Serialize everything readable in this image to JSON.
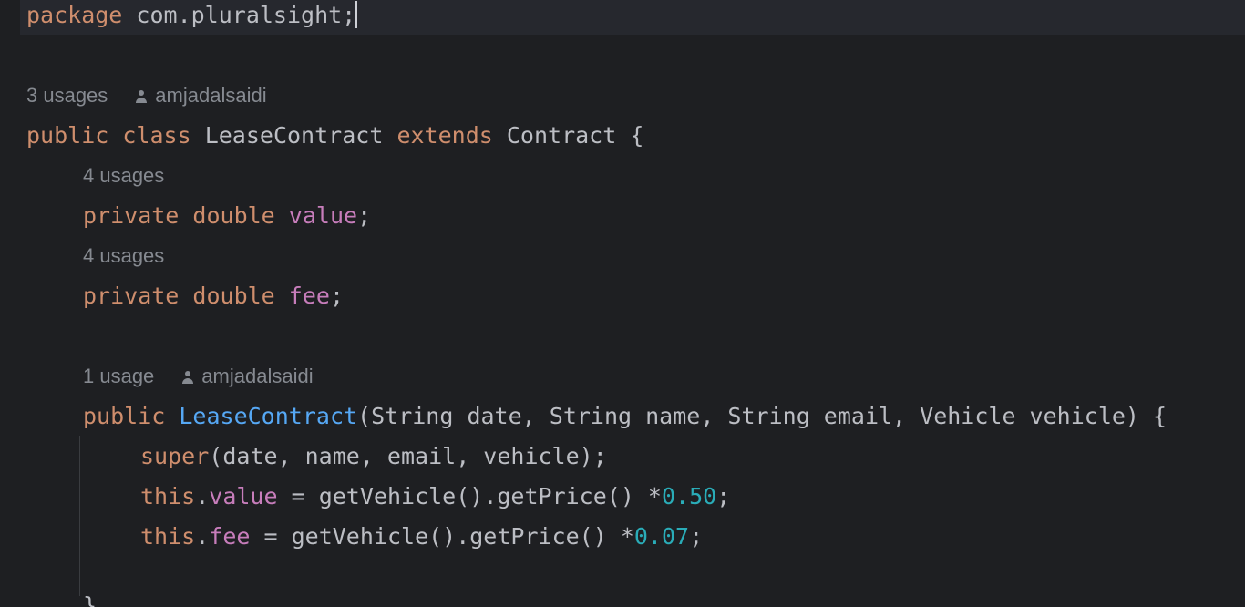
{
  "code": {
    "package_line": {
      "keyword": "package",
      "name": " com.pluralsight;"
    },
    "class_hint": {
      "usages": "3 usages",
      "author": "amjadalsaidi"
    },
    "class_line": {
      "public": "public",
      "class": "class",
      "name": "LeaseContract",
      "extends": "extends",
      "parent": "Contract {"
    },
    "field1_hint": {
      "usages": "4 usages"
    },
    "field1_line": {
      "private": "private",
      "type": "double",
      "name": "value",
      "end": ";"
    },
    "field2_hint": {
      "usages": "4 usages"
    },
    "field2_line": {
      "private": "private",
      "type": "double",
      "name": "fee",
      "end": ";"
    },
    "ctor_hint": {
      "usages": "1 usage",
      "author": "amjadalsaidi"
    },
    "ctor_line": {
      "public": "public",
      "name": "LeaseContract",
      "params": "(String date, String name, String email, Vehicle vehicle) {"
    },
    "super_line": {
      "keyword": "super",
      "args": "(date, name, email, vehicle);"
    },
    "value_assign_line": {
      "this": "this",
      "dot": ".",
      "field": "value",
      "expr": " = getVehicle().getPrice() *",
      "number": "0.50",
      "end": ";"
    },
    "fee_assign_line": {
      "this": "this",
      "dot": ".",
      "field": "fee",
      "expr": " = getVehicle().getPrice() *",
      "number": "0.07",
      "end": ";"
    },
    "closing_line": {
      "brace": "}"
    }
  },
  "colors": {
    "background": "#1e1f22",
    "keyword": "#cf8e6d",
    "field": "#c77dbb",
    "function": "#56a8f5",
    "number": "#2aacb8",
    "text": "#bcbec4",
    "hint": "#868a91"
  },
  "icons": {
    "author": "person-icon"
  }
}
